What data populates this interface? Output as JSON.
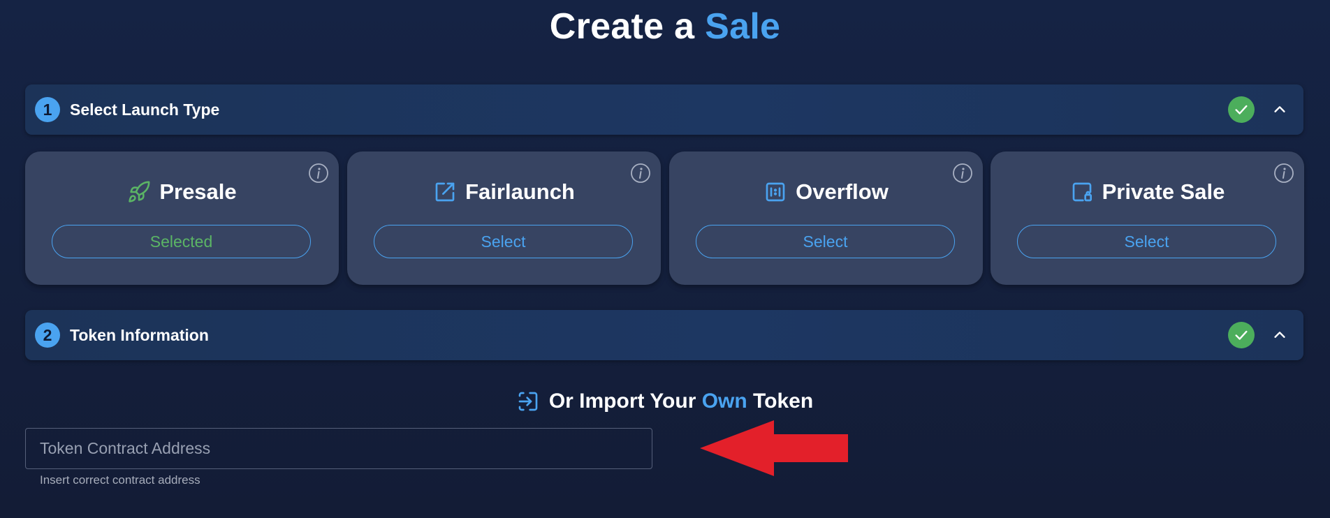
{
  "page": {
    "title_prefix": "Create a ",
    "title_accent": "Sale"
  },
  "colors": {
    "accent": "#4aa3f0",
    "success": "#5bb565",
    "card_bg": "#374462",
    "header_bg": "#1d3762",
    "arrow": "#e3202a"
  },
  "sections": [
    {
      "number": "1",
      "title": "Select Launch Type",
      "completed": true,
      "expanded": true
    },
    {
      "number": "2",
      "title": "Token Information",
      "completed": true,
      "expanded": true
    }
  ],
  "launch_types": [
    {
      "name": "Presale",
      "icon": "rocket-icon",
      "button": "Selected",
      "selected": true
    },
    {
      "name": "Fairlaunch",
      "icon": "external-link-icon",
      "button": "Select",
      "selected": false
    },
    {
      "name": "Overflow",
      "icon": "overflow-icon",
      "button": "Select",
      "selected": false
    },
    {
      "name": "Private Sale",
      "icon": "private-sale-icon",
      "button": "Select",
      "selected": false
    }
  ],
  "import_token": {
    "prefix": "Or Import Your ",
    "accent": "Own",
    "suffix": " Token",
    "icon": "import-icon",
    "placeholder": "Token Contract Address",
    "value": "",
    "helper": "Insert correct contract address"
  },
  "annotation": {
    "icon": "red-arrow-icon"
  }
}
